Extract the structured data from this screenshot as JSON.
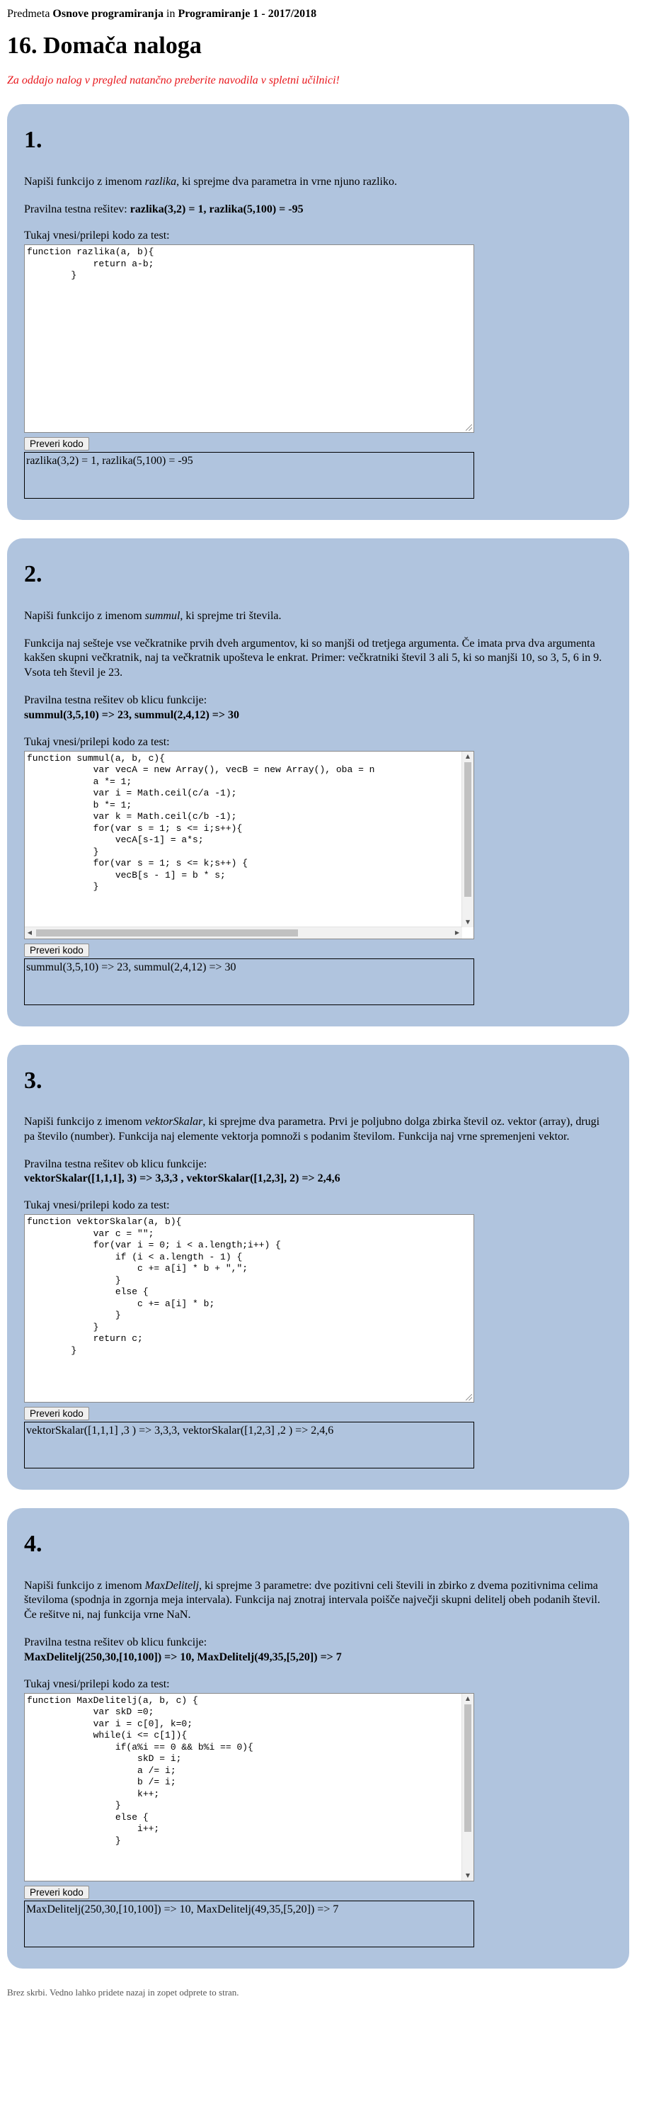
{
  "breadcrumb": {
    "prefix": "Predmeta ",
    "subject": "Osnove programiranja",
    "middle": " in ",
    "course": "Programiranje 1 - 2017/2018"
  },
  "page_title": "16. Domača naloga",
  "warning": "Za oddajo nalog v pregled natančno preberite navodila v spletni učilnici!",
  "editor_label": "Tukaj vnesi/prilepi kodo za test:",
  "check_button": "Preveri kodo",
  "tasks": [
    {
      "number": "1.",
      "desc_before": "Napiši funkcijo z imenom ",
      "fname": "razlika",
      "desc_after": ", ki sprejme dva parametra in vrne njuno razliko.",
      "extra": "",
      "tests_label": "Pravilna testna rešitev: ",
      "tests": "razlika(3,2) = 1, razlika(5,100) = -95",
      "code": "function razlika(a, b){\n            return a-b;\n        }",
      "result": "razlika(3,2) = 1, razlika(5,100) = -95"
    },
    {
      "number": "2.",
      "desc_before": "Napiši funkcijo z imenom ",
      "fname": "summul",
      "desc_after": ", ki sprejme tri števila.",
      "extra": "Funkcija naj sešteje vse večkratnike prvih dveh argumentov, ki so manjši od tretjega argumenta. Če imata prva dva argumenta kakšen skupni večkratnik, naj ta večkratnik upošteva le enkrat. Primer: večkratniki števil 3 ali 5, ki so manjši 10, so 3, 5, 6 in 9. Vsota teh števil je 23.",
      "tests_label": "Pravilna testna rešitev ob klicu funkcije:",
      "tests": "summul(3,5,10) => 23, summul(2,4,12) => 30",
      "code": "function summul(a, b, c){\n            var vecA = new Array(), vecB = new Array(), oba = n\n            a *= 1;\n            var i = Math.ceil(c/a -1);\n            b *= 1;\n            var k = Math.ceil(c/b -1);\n            for(var s = 1; s <= i;s++){\n                vecA[s-1] = a*s;\n            }\n            for(var s = 1; s <= k;s++) {\n                vecB[s - 1] = b * s;\n            }",
      "result": "summul(3,5,10) => 23, summul(2,4,12) => 30"
    },
    {
      "number": "3.",
      "desc_before": "Napiši funkcijo z imenom ",
      "fname": "vektorSkalar",
      "desc_after": ", ki sprejme dva parametra. Prvi je poljubno dolga zbirka števil oz. vektor (array), drugi pa število (number). Funkcija naj elemente vektorja pomnoži s podanim številom. Funkcija naj vrne spremenjeni vektor.",
      "extra": "",
      "tests_label": "Pravilna testna rešitev ob klicu funkcije:",
      "tests": "vektorSkalar([1,1,1], 3) => 3,3,3 , vektorSkalar([1,2,3], 2) => 2,4,6",
      "code": "function vektorSkalar(a, b){\n            var c = \"\";\n            for(var i = 0; i < a.length;i++) {\n                if (i < a.length - 1) {\n                    c += a[i] * b + \",\";\n                }\n                else {\n                    c += a[i] * b;\n                }\n            }\n            return c;\n        }",
      "result": "vektorSkalar([1,1,1] ,3 ) => 3,3,3, vektorSkalar([1,2,3] ,2 ) => 2,4,6"
    },
    {
      "number": "4.",
      "desc_before": "Napiši funkcijo z imenom ",
      "fname": "MaxDelitelj",
      "desc_after": ", ki sprejme 3 parametre: dve pozitivni celi števili in zbirko z dvema pozitivnima celima številoma (spodnja in zgornja meja intervala). Funkcija naj znotraj intervala poišče največji skupni delitelj obeh podanih števil. Če rešitve ni, naj funkcija vrne NaN.",
      "extra": "",
      "tests_label": "Pravilna testna rešitev ob klicu funkcije:",
      "tests": "MaxDelitelj(250,30,[10,100]) => 10, MaxDelitelj(49,35,[5,20]) => 7",
      "code": "function MaxDelitelj(a, b, c) {\n            var skD =0;\n            var i = c[0], k=0;\n            while(i <= c[1]){\n                if(a%i == 0 && b%i == 0){\n                    skD = i;\n                    a /= i;\n                    b /= i;\n                    k++;\n                }\n                else {\n                    i++;\n                }",
      "result": "MaxDelitelj(250,30,[10,100]) => 10, MaxDelitelj(49,35,[5,20]) => 7"
    }
  ],
  "footer": "Brez skrbi. Vedno lahko pridete nazaj in zopet odprete to stran."
}
